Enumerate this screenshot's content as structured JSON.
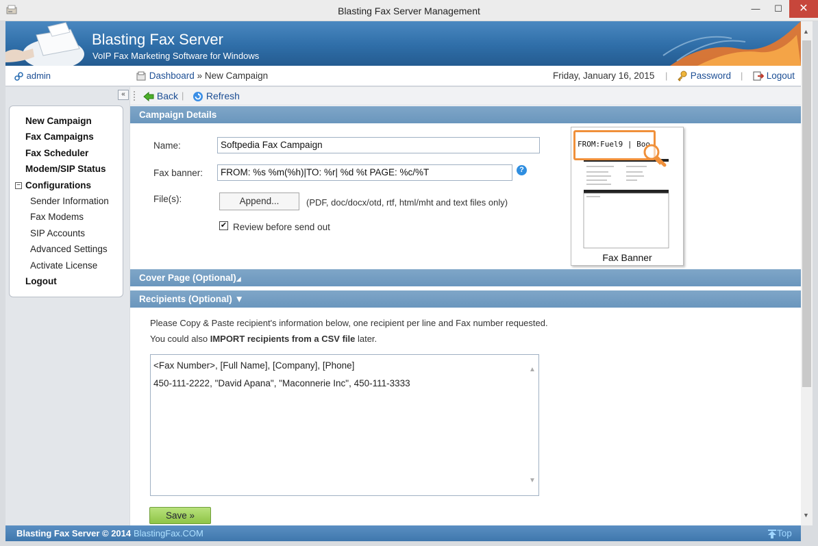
{
  "window": {
    "title": "Blasting Fax Server Management",
    "minimize_glyph": "—",
    "maximize_glyph": "☐",
    "close_glyph": "✕"
  },
  "banner": {
    "brand": "Blasting Fax Server",
    "tagline": "VoIP Fax Marketing Software for Windows"
  },
  "infobar": {
    "user": "admin",
    "breadcrumb_link": "Dashboard",
    "breadcrumb_sep": "»",
    "breadcrumb_current": "New Campaign",
    "date": "Friday, January 16, 2015",
    "password_link": "Password",
    "logout_link": "Logout"
  },
  "sidebar": {
    "collapse_glyph": "«",
    "items": [
      {
        "label": "New Campaign"
      },
      {
        "label": "Fax Campaigns"
      },
      {
        "label": "Fax Scheduler"
      },
      {
        "label": "Modem/SIP Status"
      },
      {
        "label": "Configurations"
      }
    ],
    "config_items": [
      {
        "label": "Sender Information"
      },
      {
        "label": "Fax Modems"
      },
      {
        "label": "SIP Accounts"
      },
      {
        "label": "Advanced Settings"
      },
      {
        "label": "Activate License"
      }
    ],
    "logout": "Logout"
  },
  "toolbar": {
    "back": "Back",
    "refresh": "Refresh"
  },
  "campaign": {
    "section_title": "Campaign Details",
    "name_label": "Name:",
    "name_value": "Softpedia Fax Campaign",
    "banner_label": "Fax banner:",
    "banner_value": "FROM: %s %m(%h)|TO: %r| %d %t PAGE: %c/%T",
    "files_label": "File(s):",
    "append_button": "Append...",
    "files_hint": "(PDF, doc/docx/otd, rtf, html/mht and text files only)",
    "review_label": "Review before send out",
    "review_checked": true,
    "preview_highlight": "FROM:Fuel9 | Boo",
    "preview_caption": "Fax Banner"
  },
  "cover_page": {
    "section_title": "Cover Page (Optional)",
    "toggle_glyph": "◢"
  },
  "recipients": {
    "section_title": "Recipients (Optional) ▼",
    "desc_line1": "Please Copy & Paste recipient's information below, one recipient per line and Fax number requested.",
    "desc_line2_pre": "You could also ",
    "desc_line2_bold": "IMPORT recipients from a CSV file",
    "desc_line2_post": " later.",
    "lines": [
      "<Fax Number>, [Full Name], [Company], [Phone]",
      "450-111-2222, \"David Apana\", \"Maconnerie Inc\", 450-111-3333"
    ],
    "save_button": "Save »"
  },
  "footer": {
    "copyright": "Blasting Fax Server © 2014",
    "site": "BlastingFax.COM",
    "top_link": "Top"
  },
  "colors": {
    "accent_blue": "#1c4e94",
    "section_bg": "#7fa6c8",
    "save_green": "#8fc447",
    "highlight_orange": "#f0903a",
    "close_red": "#c7463b"
  }
}
